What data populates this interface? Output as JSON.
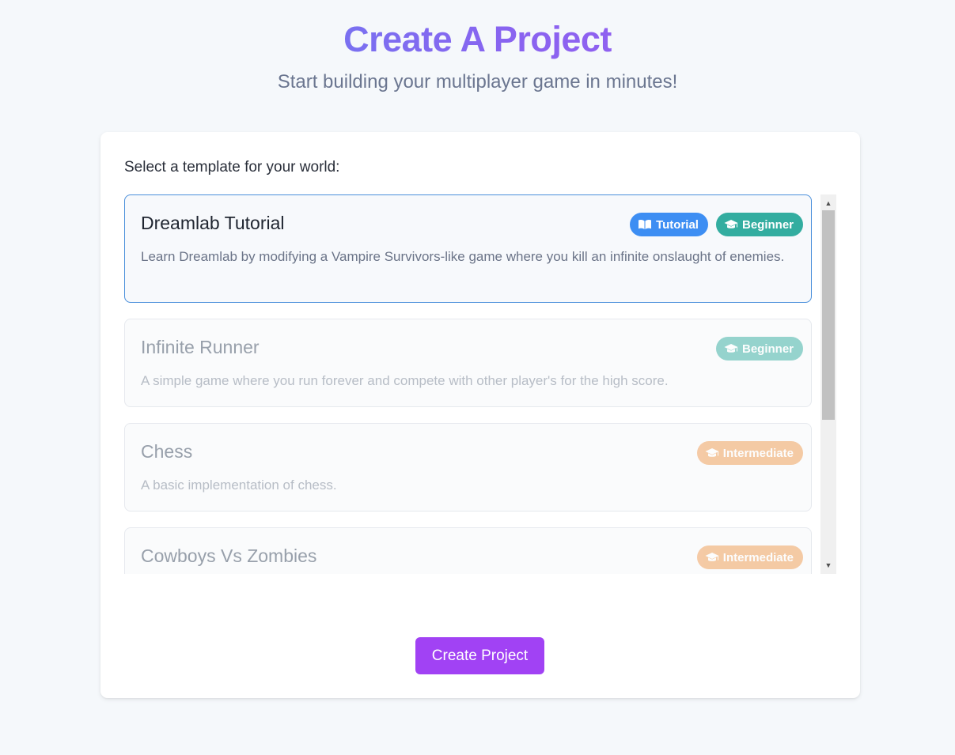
{
  "header": {
    "title": "Create A Project",
    "subtitle": "Start building your multiplayer game in minutes!"
  },
  "form": {
    "select_label": "Select a template for your world:",
    "submit_label": "Create Project"
  },
  "templates": [
    {
      "title": "Dreamlab Tutorial",
      "description": "Learn Dreamlab by modifying a Vampire Survivors-like game where you kill an infinite onslaught of enemies.",
      "selected": true,
      "badges": [
        {
          "label": "Tutorial",
          "icon": "book-icon",
          "color": "#3d8ef3"
        },
        {
          "label": "Beginner",
          "icon": "graduation-cap-icon",
          "color": "#33ada0"
        }
      ]
    },
    {
      "title": "Infinite Runner",
      "description": "A simple game where you run forever and compete with other player's for the high score.",
      "selected": false,
      "badges": [
        {
          "label": "Beginner",
          "icon": "graduation-cap-icon",
          "color": "#33ada0"
        }
      ]
    },
    {
      "title": "Chess",
      "description": "A basic implementation of chess.",
      "selected": false,
      "badges": [
        {
          "label": "Intermediate",
          "icon": "graduation-cap-icon",
          "color": "#f09a4f"
        }
      ]
    },
    {
      "title": "Cowboys Vs Zombies",
      "description": "",
      "selected": false,
      "badges": [
        {
          "label": "Intermediate",
          "icon": "graduation-cap-icon",
          "color": "#f09a4f"
        }
      ]
    }
  ],
  "colors": {
    "accent_purple": "#a142f4",
    "selected_border": "#4a8fdb",
    "tutorial_badge": "#3d8ef3",
    "beginner_badge": "#33ada0",
    "intermediate_badge": "#f09a4f"
  }
}
